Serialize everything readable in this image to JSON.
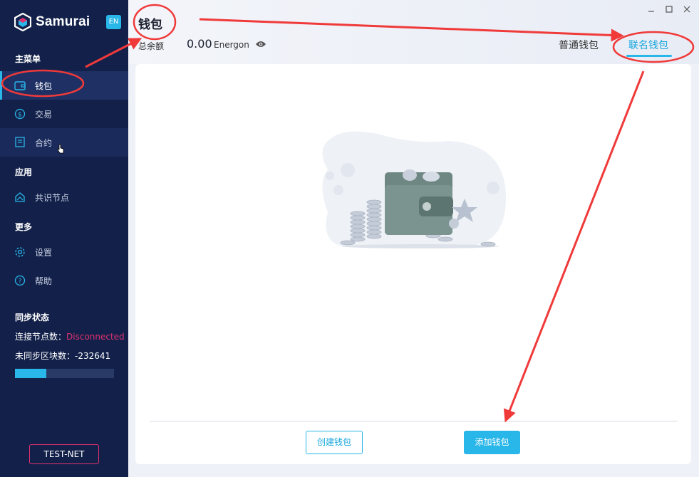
{
  "app": {
    "brand_name": "Samurai",
    "lang_badge": "EN"
  },
  "sidebar": {
    "sections": {
      "main": "主菜单",
      "apps": "应用",
      "more": "更多"
    },
    "items": [
      {
        "label": "钱包",
        "icon": "wallet-icon",
        "active": true
      },
      {
        "label": "交易",
        "icon": "dollar-circle-icon"
      },
      {
        "label": "合约",
        "icon": "contract-icon"
      },
      {
        "label": "共识节点",
        "icon": "consensus-node-icon"
      },
      {
        "label": "设置",
        "icon": "gear-icon"
      },
      {
        "label": "帮助",
        "icon": "help-icon"
      }
    ],
    "sync": {
      "title": "同步状态",
      "nodes_label": "连接节点数：",
      "nodes_value": "Disconnected",
      "blocks_label": "未同步区块数：",
      "blocks_value": "-232641",
      "progress": 0.32
    },
    "network_button": "TEST-NET"
  },
  "header": {
    "title": "钱包",
    "balance_label": "总余额",
    "balance_value": "0.00",
    "balance_unit": "Energon",
    "tabs": [
      {
        "label": "普通钱包",
        "active": false
      },
      {
        "label": "联名钱包",
        "active": true
      }
    ]
  },
  "main": {
    "create_button": "创建钱包",
    "add_button": "添加钱包"
  },
  "colors": {
    "accent": "#29b6e8",
    "sidebar_bg": "#13214a",
    "danger": "#e0316f",
    "annotation": "#f03a3a"
  }
}
